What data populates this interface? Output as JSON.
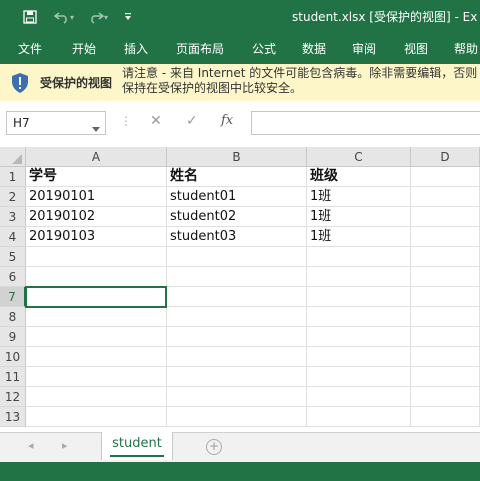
{
  "window": {
    "title": "student.xlsx  [受保护的视图]  -  Ex",
    "quick_access": {
      "save_icon": "save-icon",
      "undo_icon": "undo-icon",
      "redo_icon": "redo-icon",
      "customize_icon": "chevron-down-icon"
    }
  },
  "ribbon_tabs": [
    "文件",
    "开始",
    "插入",
    "页面布局",
    "公式",
    "数据",
    "审阅",
    "视图",
    "帮助"
  ],
  "protected_view": {
    "title": "受保护的视图",
    "message": "请注意 - 来自 Internet 的文件可能包含病毒。除非需要编辑，否则保持在受保护的视图中比较安全。",
    "icon": "shield-icon"
  },
  "formula_bar": {
    "name_box": "H7",
    "cancel_symbol": "✕",
    "enter_symbol": "✓",
    "fx_label": "fx",
    "formula": ""
  },
  "sheet": {
    "columns": [
      "A",
      "B",
      "C",
      "D"
    ],
    "rows": [
      "1",
      "2",
      "3",
      "4",
      "5",
      "6",
      "7",
      "8",
      "9",
      "10",
      "11",
      "12",
      "13"
    ],
    "active_row": "7",
    "cells": [
      [
        "学号",
        "姓名",
        "班级"
      ],
      [
        "20190101",
        "student01",
        "1班"
      ],
      [
        "20190102",
        "student02",
        "1班"
      ],
      [
        "20190103",
        "student03",
        "1班"
      ]
    ]
  },
  "sheet_tabs": {
    "active": "student",
    "add_icon": "plus-icon"
  },
  "colors": {
    "accent": "#217346",
    "protected_bar": "#fdf6c8",
    "header_bg": "#e6e6e6"
  }
}
